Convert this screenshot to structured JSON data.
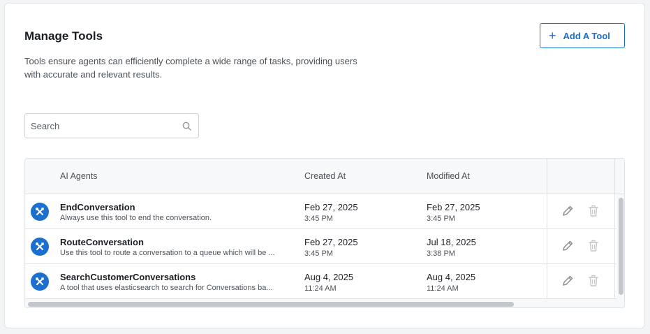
{
  "header": {
    "title": "Manage Tools",
    "description": "Tools ensure agents can efficiently complete a wide range of tasks, providing users with accurate and relevant results.",
    "add_button_label": "Add A Tool",
    "add_button_icon": "plus-icon"
  },
  "search": {
    "placeholder": "Search",
    "value": "",
    "icon": "search-icon"
  },
  "table": {
    "columns": [
      "AI Agents",
      "Created At",
      "Modified At"
    ],
    "rows": [
      {
        "name": "EndConversation",
        "description": "Always use this tool to end the conversation.",
        "created_date": "Feb 27, 2025",
        "created_time": "3:45 PM",
        "modified_date": "Feb 27, 2025",
        "modified_time": "3:45 PM"
      },
      {
        "name": "RouteConversation",
        "description": "Use this tool to route a conversation to a queue which will be ...",
        "created_date": "Feb 27, 2025",
        "created_time": "3:45 PM",
        "modified_date": "Jul 18, 2025",
        "modified_time": "3:38 PM"
      },
      {
        "name": "SearchCustomerConversations",
        "description": "A tool that uses elasticsearch to search for Conversations ba...",
        "created_date": "Aug 4, 2025",
        "created_time": "11:24 AM",
        "modified_date": "Aug 4, 2025",
        "modified_time": "11:24 AM"
      }
    ],
    "row_icon": "tools-icon",
    "edit_icon": "pencil-icon",
    "delete_icon": "trash-icon"
  },
  "colors": {
    "accent": "#1a6fcf",
    "border": "#dfe2e6",
    "header_bg": "#f7f8f9",
    "icon_gray": "#8a8f95",
    "disabled_gray": "#c4c7cb"
  }
}
